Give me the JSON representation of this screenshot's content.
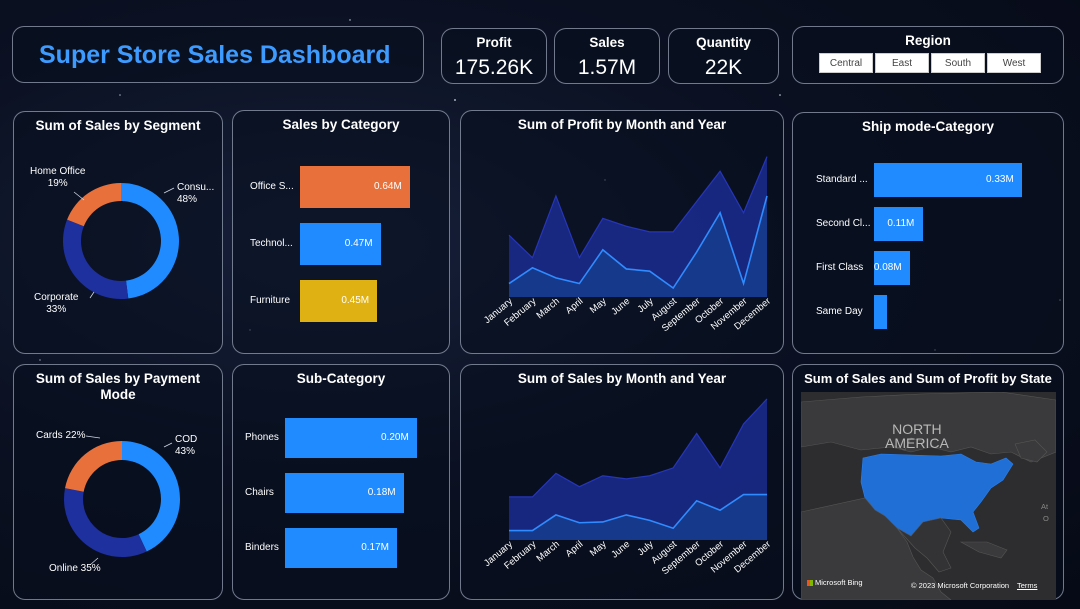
{
  "dashboard": {
    "title": "Super Store Sales Dashboard"
  },
  "kpis": [
    {
      "label": "Profit",
      "value": "175.26K"
    },
    {
      "label": "Sales",
      "value": "1.57M"
    },
    {
      "label": "Quantity",
      "value": "22K"
    }
  ],
  "region": {
    "title": "Region",
    "options": [
      "Central",
      "East",
      "South",
      "West"
    ]
  },
  "segment": {
    "title": "Sum of Sales by Segment",
    "slices": [
      {
        "name": "Consu...",
        "percent": "48%",
        "value": 48,
        "color": "#1f8bff"
      },
      {
        "name": "Corporate",
        "percent": "33%",
        "value": 33,
        "color": "#1e2f9e"
      },
      {
        "name": "Home Office",
        "percent": "19%",
        "value": 19,
        "color": "#e8703a"
      }
    ]
  },
  "payment": {
    "title_line1": "Sum of Sales by Payment",
    "title_line2": "Mode",
    "slices": [
      {
        "name": "COD",
        "percent": "43%",
        "value": 43,
        "color": "#1f8bff"
      },
      {
        "name": "Online",
        "percent": "35%",
        "value": 35,
        "color": "#1e2f9e"
      },
      {
        "name": "Cards",
        "percent": "22%",
        "value": 22,
        "color": "#e8703a"
      }
    ],
    "cards_label": "Cards 22%",
    "online_label": "Online 35%"
  },
  "category": {
    "title": "Sales by Category",
    "items": [
      {
        "label": "Office S...",
        "value": 0.64,
        "text": "0.64M",
        "color": "#e8703a"
      },
      {
        "label": "Technol...",
        "value": 0.47,
        "text": "0.47M",
        "color": "#1f8bff"
      },
      {
        "label": "Furniture",
        "value": 0.45,
        "text": "0.45M",
        "color": "#e0b112"
      }
    ]
  },
  "subcategory": {
    "title": "Sub-Category",
    "items": [
      {
        "label": "Phones",
        "value": 0.2,
        "text": "0.20M"
      },
      {
        "label": "Chairs",
        "value": 0.18,
        "text": "0.18M"
      },
      {
        "label": "Binders",
        "value": 0.17,
        "text": "0.17M"
      }
    ]
  },
  "shipmode": {
    "title": "Ship mode-Category",
    "items": [
      {
        "label": "Standard ...",
        "value": 0.33,
        "text": "0.33M"
      },
      {
        "label": "Second Cl...",
        "value": 0.11,
        "text": "0.11M"
      },
      {
        "label": "First Class",
        "value": 0.08,
        "text": "0.08M"
      },
      {
        "label": "Same Day",
        "value": 0.03,
        "text": ""
      }
    ]
  },
  "months": [
    "January",
    "February",
    "March",
    "April",
    "May",
    "June",
    "July",
    "August",
    "September",
    "October",
    "November",
    "December"
  ],
  "profit_chart": {
    "title": "Sum of Profit by Month and Year",
    "upper": [
      0.55,
      0.35,
      0.9,
      0.35,
      0.7,
      0.63,
      0.58,
      0.58,
      0.85,
      1.12,
      0.75,
      1.25
    ],
    "lower": [
      0.12,
      0.26,
      0.17,
      0.12,
      0.42,
      0.25,
      0.23,
      0.08,
      0.4,
      0.75,
      0.12,
      0.9
    ]
  },
  "sales_chart": {
    "title": "Sum of Sales by Month and Year",
    "upper": [
      0.55,
      0.55,
      0.85,
      0.68,
      0.82,
      0.78,
      0.82,
      0.92,
      1.36,
      0.92,
      1.48,
      1.8
    ],
    "lower": [
      0.12,
      0.12,
      0.32,
      0.22,
      0.23,
      0.32,
      0.25,
      0.15,
      0.5,
      0.38,
      0.58,
      0.58
    ]
  },
  "map": {
    "title": "Sum of Sales and Sum of Profit by State",
    "label_line1": "NORTH",
    "label_line2": "AMERICA",
    "brand": "Microsoft Bing",
    "copyright": "© 2023 Microsoft Corporation",
    "terms": "Terms",
    "side_label": "At",
    "side_label2": "O"
  },
  "colors": {
    "accent": "#1f8bff",
    "orange": "#e8703a",
    "gold": "#e0b112",
    "navy": "#1e2f9e"
  }
}
